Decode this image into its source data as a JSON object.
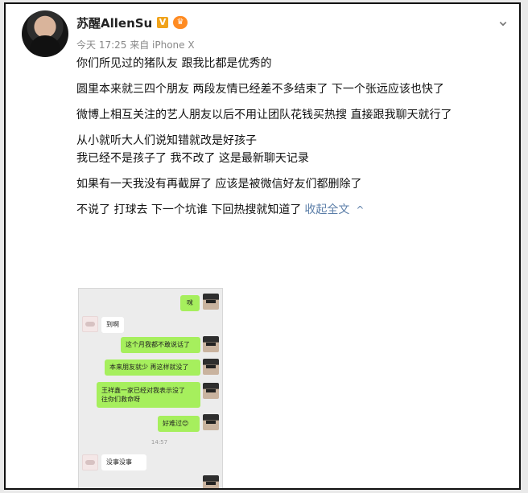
{
  "header": {
    "name": "苏醒AllenSu",
    "verified_badge": "V",
    "vip_badge": "♛",
    "meta": "今天 17:25 来自 iPhone X",
    "menu_icon": "chevron-down-icon"
  },
  "post": {
    "lines": [
      "你们所见过的猪队友 跟我比都是优秀的",
      "圆里本来就三四个朋友 两段友情已经差不多结束了 下一个张远应该也快了",
      "微博上相互关注的艺人朋友以后不用让团队花钱买热搜 直接跟我聊天就行了",
      "从小就听大人们说知错就改是好孩子",
      "我已经不是孩子了 我不改了 这是最新聊天记录",
      "如果有一天我没有再截屏了 应该是被微信好友们都删除了",
      "不说了 打球去 下一个坑谁 下回热搜就知道了"
    ],
    "collapse_label": "收起全文",
    "collapse_icon": "^"
  },
  "chat": {
    "messages": [
      "咪",
      "到啊",
      "这个月我都不敢说话了",
      "本来朋友就少 再这样就没了",
      "王祥鑫一家已经对我表示没了\n往你们救命呀",
      "好难过😊",
      "14:57",
      "没事没事"
    ]
  }
}
